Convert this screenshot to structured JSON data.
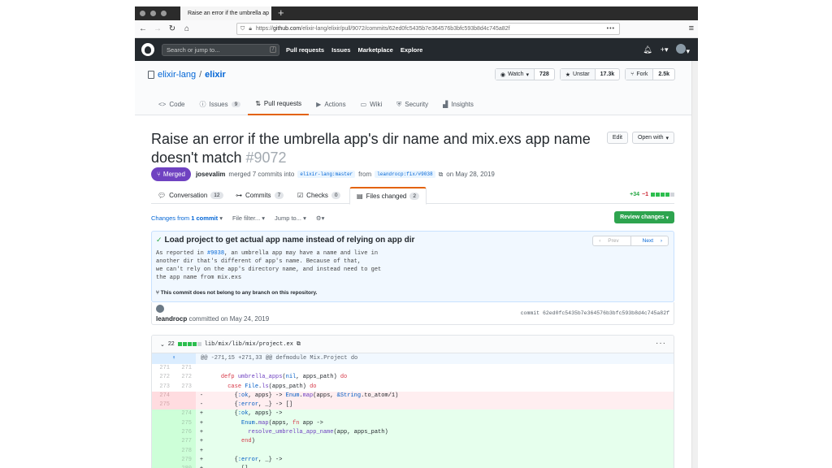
{
  "browser": {
    "tab_title": "Raise an error if the umbrella ap",
    "url_prefix": "https://",
    "url_host": "github.com",
    "url_path": "/elixir-lang/elixir/pull/9072/commits/62ed0fc5435b7e364576b3bfc593b8d4c745a82f"
  },
  "gh": {
    "search_placeholder": "Search or jump to...",
    "search_key": "/",
    "nav": [
      "Pull requests",
      "Issues",
      "Marketplace",
      "Explore"
    ]
  },
  "repo": {
    "owner": "elixir-lang",
    "sep": "/",
    "name": "elixir",
    "watch_label": "Watch",
    "watch_count": "728",
    "unstar_label": "Unstar",
    "star_count": "17.3k",
    "fork_label": "Fork",
    "fork_count": "2.5k",
    "tabs": [
      {
        "label": "Code",
        "icon": "<>"
      },
      {
        "label": "Issues",
        "icon": "ⓘ",
        "count": "9"
      },
      {
        "label": "Pull requests",
        "icon": "⇅"
      },
      {
        "label": "Actions",
        "icon": "▶"
      },
      {
        "label": "Wiki",
        "icon": "▭"
      },
      {
        "label": "Security",
        "icon": "⛨"
      },
      {
        "label": "Insights",
        "icon": "▟"
      }
    ]
  },
  "pr": {
    "title": "Raise an error if the umbrella app's dir name and mix.exs app name doesn't match",
    "number": "#9072",
    "state": "Merged",
    "edit_label": "Edit",
    "open_with_label": "Open with",
    "author": "josevalim",
    "merged_text": "merged 7 commits into",
    "base": "elixir-lang:master",
    "from": "from",
    "head": "leandrocp:fix/#9038",
    "date": "on May 28, 2019",
    "tabs": [
      {
        "label": "Conversation",
        "count": "12"
      },
      {
        "label": "Commits",
        "count": "7"
      },
      {
        "label": "Checks",
        "count": "0"
      },
      {
        "label": "Files changed",
        "count": "2"
      }
    ],
    "additions": "+34",
    "deletions": "−1"
  },
  "toolbar": {
    "changes_from": "Changes from",
    "one_commit": "1 commit",
    "file_filter": "File filter...",
    "jump_to": "Jump to...",
    "review_label": "Review changes"
  },
  "commit": {
    "title": "Load project to get actual app name instead of relying on app dir",
    "prev": "Prev",
    "next": "Next",
    "body_1": "As reported in ",
    "body_link": "#9038",
    "body_2": ", an umbrella app may have a name and live in\nanother dir that's different of app's name. Because of that,\nwe can't rely on the app's directory name, and instead need to get\nthe app name from mix.exs",
    "no_branch": "This commit does not belong to any branch on this repository.",
    "author": "leandrocp",
    "committed": "committed on May 24, 2019",
    "sha_label": "commit",
    "sha": "62ed0fc5435b7e364576b3bfc593b8d4c745a82f"
  },
  "file": {
    "changes": "22",
    "path": "lib/mix/lib/mix/project.ex",
    "hunk": "@@ -271,15 +271,33 @@ defmodule Mix.Project do",
    "lines": [
      {
        "t": "ctx",
        "o": "271",
        "n": "271",
        "s": " ",
        "c": ""
      },
      {
        "t": "ctx",
        "o": "272",
        "n": "272",
        "s": " ",
        "c": "    defp umbrella_apps(nil, apps_path) do"
      },
      {
        "t": "ctx",
        "o": "273",
        "n": "273",
        "s": " ",
        "c": "      case File.ls(apps_path) do"
      },
      {
        "t": "rm",
        "o": "274",
        "n": "",
        "s": "-",
        "c": "        {:ok, apps} -> Enum.map(apps, &String.to_atom/1)"
      },
      {
        "t": "rm",
        "o": "275",
        "n": "",
        "s": "-",
        "c": "        {:error, _} -> []"
      },
      {
        "t": "ad",
        "o": "",
        "n": "274",
        "s": "+",
        "c": "        {:ok, apps} ->"
      },
      {
        "t": "ad",
        "o": "",
        "n": "275",
        "s": "+",
        "c": "          Enum.map(apps, fn app ->"
      },
      {
        "t": "ad",
        "o": "",
        "n": "276",
        "s": "+",
        "c": "            resolve_umbrella_app_name(app, apps_path)"
      },
      {
        "t": "ad",
        "o": "",
        "n": "277",
        "s": "+",
        "c": "          end)"
      },
      {
        "t": "ad",
        "o": "",
        "n": "278",
        "s": "+",
        "c": ""
      },
      {
        "t": "ad",
        "o": "",
        "n": "279",
        "s": "+",
        "c": "        {:error, _} ->"
      },
      {
        "t": "ad",
        "o": "",
        "n": "280",
        "s": "+",
        "c": "          []"
      }
    ]
  },
  "colors": {
    "merged": "#6f42c1",
    "accent_tab": "#e36209",
    "link": "#0366d6",
    "add": "#28a745",
    "del": "#cb2431"
  }
}
